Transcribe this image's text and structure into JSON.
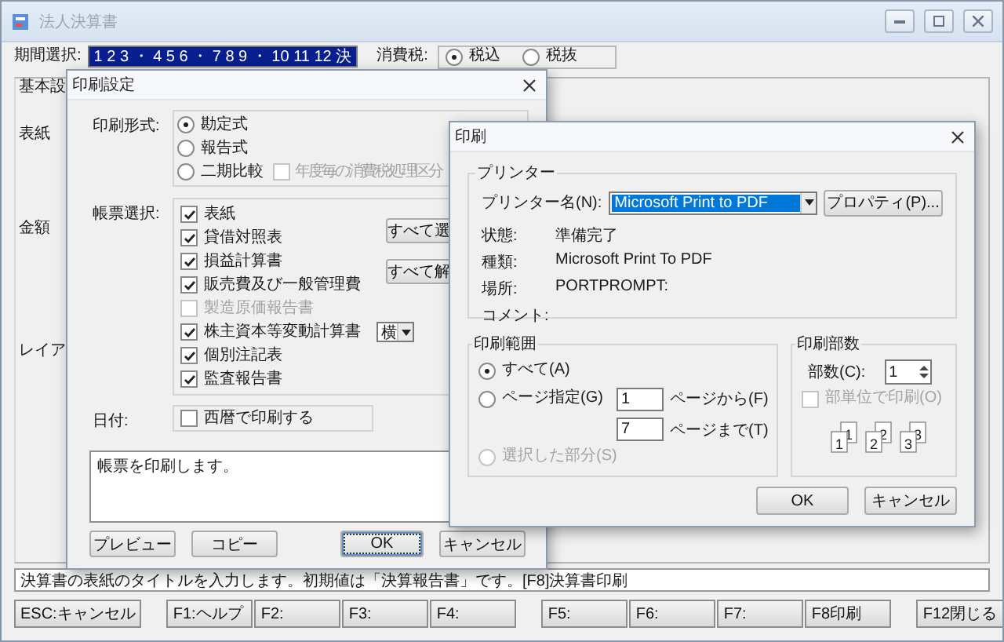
{
  "main_window": {
    "title": "法人決算書",
    "period_label": "期間選択:",
    "period_value": "1 2 3 ・ 4 5 6 ・ 7 8 9 ・ 10 11 12 決",
    "tax_label": "消費税:",
    "tax_options": [
      {
        "label": "税込",
        "selected": true
      },
      {
        "label": "税抜",
        "selected": false
      }
    ],
    "side_labels": [
      "基本設",
      "表紙",
      "金額",
      "レイア"
    ],
    "status_text": "決算書の表紙のタイトルを入力します。初期値は「決算報告書」です。[F8]決算書印刷",
    "function_key_groups": [
      [
        "ESC:キャンセル"
      ],
      [
        "F1:ヘルプ",
        "F2:",
        "F3:",
        "F4:"
      ],
      [
        "F5:",
        "F6:",
        "F7:",
        "F8印刷"
      ],
      [
        "F12閉じる"
      ]
    ]
  },
  "print_settings_dialog": {
    "title": "印刷設定",
    "format_label": "印刷形式:",
    "formats": [
      {
        "label": "勘定式",
        "selected": true
      },
      {
        "label": "報告式",
        "selected": false
      },
      {
        "label": "二期比較",
        "selected": false
      }
    ],
    "yearly_tax_option": {
      "label": "年度毎の消費税処理区分",
      "checked": false,
      "disabled": true
    },
    "forms_label": "帳票選択:",
    "forms": [
      {
        "label": "表紙",
        "checked": true,
        "disabled": false
      },
      {
        "label": "貸借対照表",
        "checked": true,
        "disabled": false
      },
      {
        "label": "損益計算書",
        "checked": true,
        "disabled": false
      },
      {
        "label": "販売費及び一般管理費",
        "checked": true,
        "disabled": false
      },
      {
        "label": "製造原価報告書",
        "checked": false,
        "disabled": true
      },
      {
        "label": "株主資本等変動計算書",
        "checked": true,
        "disabled": false,
        "orientation": "横"
      },
      {
        "label": "個別注記表",
        "checked": true,
        "disabled": false
      },
      {
        "label": "監査報告書",
        "checked": true,
        "disabled": false
      }
    ],
    "select_all_button": "すべて選",
    "deselect_all_button": "すべて解",
    "date_label": "日付:",
    "western_date": {
      "label": "西暦で印刷する",
      "checked": false
    },
    "message": "帳票を印刷します。",
    "buttons": [
      {
        "label": "プレビュー",
        "focused": false
      },
      {
        "label": "コピー",
        "focused": false
      },
      {
        "label": "OK",
        "focused": true
      },
      {
        "label": "キャンセル",
        "focused": false
      }
    ]
  },
  "print_dialog": {
    "title": "印刷",
    "printer": {
      "group_title": "プリンター",
      "name_label": "プリンター名(N):",
      "name_value": "Microsoft Print to PDF",
      "properties_button": "プロパティ(P)...",
      "info": [
        {
          "label": "状態:",
          "value": "準備完了"
        },
        {
          "label": "種類:",
          "value": "Microsoft Print To PDF"
        },
        {
          "label": "場所:",
          "value": "PORTPROMPT:"
        },
        {
          "label": "コメント:"
        }
      ]
    },
    "range": {
      "group_title": "印刷範囲",
      "options": [
        {
          "kind": "all",
          "label": "すべて(A)",
          "selected": true,
          "disabled": false
        },
        {
          "kind": "pages",
          "label": "ページ指定(G)",
          "selected": false,
          "disabled": false
        },
        {
          "kind": "selection",
          "label": "選択した部分(S)",
          "selected": false,
          "disabled": true
        }
      ],
      "from_value": "1",
      "from_label": "ページから(F)",
      "to_value": "7",
      "to_label": "ページまで(T)"
    },
    "copies": {
      "group_title": "印刷部数",
      "count_label": "部数(C):",
      "count_value": "1",
      "collate": {
        "label": "部単位で印刷(O)",
        "checked": false,
        "disabled": true
      },
      "collate_pages": [
        "1",
        "1",
        "2",
        "2",
        "3",
        "3"
      ]
    },
    "buttons": [
      {
        "label": "OK",
        "focused": false
      },
      {
        "label": "キャンセル",
        "focused": false
      }
    ]
  }
}
